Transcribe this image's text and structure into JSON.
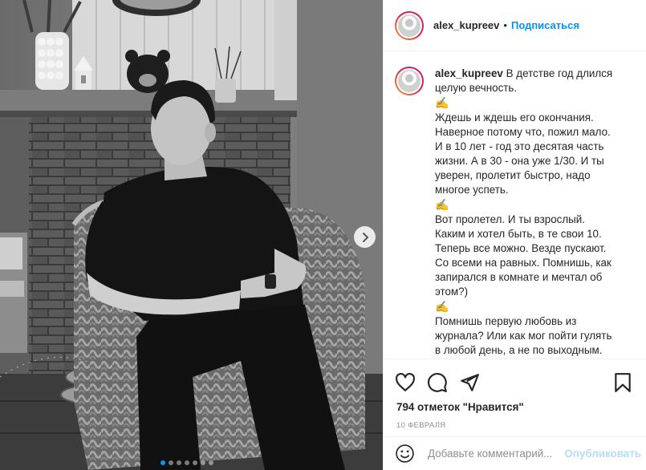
{
  "post": {
    "username": "alex_kupreev",
    "separator": "•",
    "follow_label": "Подписаться",
    "caption": {
      "username": "alex_kupreev",
      "paragraph_1": "В детстве год длился целую вечность.",
      "paragraph_2": "Ждешь и ждешь его окончания. Наверное потому что, пожил мало. И в 10 лет - год это десятая часть жизни. А в 30 - она уже 1/30. И ты уверен, пролетит быстро, надо многое успеть.",
      "paragraph_3": "Вот пролетел. И ты взрослый. Каким и хотел быть, в те свои 10. Теперь все можно. Везде пускают. Со всеми на равных. Помнишь, как запирался в комнате и мечтал об этом?)",
      "paragraph_4": "Помнишь первую любовь из журнала? Или как мог пойти гулять в любой день, а не по выходным. Помнишь, первые драки? А как папа",
      "emoji": "✍"
    },
    "likes_text": "794 отметок \"Нравится\"",
    "date_text": "10 ФЕВРАЛЯ",
    "comment_placeholder": "Добавьте комментарий...",
    "publish_label": "Опубликовать"
  },
  "carousel": {
    "total": 7,
    "active_index": 0
  },
  "icons": {
    "like": "heart-icon",
    "comment": "comment-icon",
    "share": "share-icon",
    "save": "bookmark-icon",
    "emoji": "smile-icon",
    "next": "chevron-right-icon"
  },
  "colors": {
    "link": "#0095f6",
    "publish_disabled": "#b2dffc",
    "muted": "#8e8e8e"
  }
}
